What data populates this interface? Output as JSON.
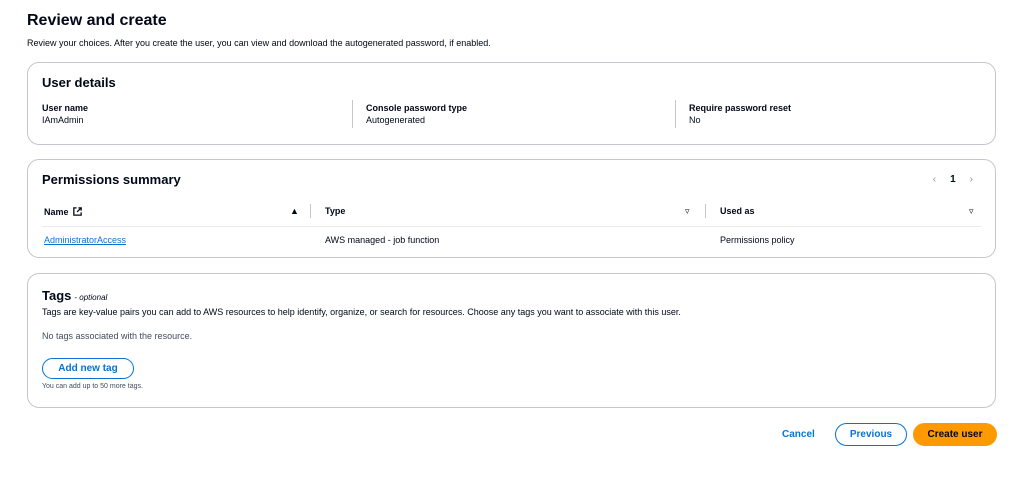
{
  "header": {
    "title": "Review and create",
    "description": "Review your choices. After you create the user, you can view and download the autogenerated password, if enabled."
  },
  "user_details": {
    "title": "User details",
    "fields": [
      {
        "label": "User name",
        "value": "IAmAdmin"
      },
      {
        "label": "Console password type",
        "value": "Autogenerated"
      },
      {
        "label": "Require password reset",
        "value": "No"
      }
    ]
  },
  "permissions": {
    "title": "Permissions summary",
    "pager": {
      "prev": "‹",
      "page": "1",
      "next": "›"
    },
    "columns": [
      "Name",
      "Type",
      "Used as"
    ],
    "icons": {
      "name_col": "external-link-icon",
      "sort_asc": "▲",
      "sort_down": "▿"
    },
    "rows": [
      {
        "name": "AdministratorAccess",
        "type": "AWS managed - job function",
        "used_as": "Permissions policy"
      }
    ]
  },
  "tags": {
    "title": "Tags",
    "optional": "- optional",
    "description": "Tags are key-value pairs you can add to AWS resources to help identify, organize, or search for resources. Choose any tags you want to associate with this user.",
    "empty": "No tags associated with the resource.",
    "add_button": "Add new tag",
    "limit_note": "You can add up to 50 more tags."
  },
  "footer": {
    "cancel": "Cancel",
    "previous": "Previous",
    "create": "Create user"
  },
  "colors": {
    "primary": "#ff9900",
    "link": "#0972d3",
    "border": "#c6c6cd"
  }
}
